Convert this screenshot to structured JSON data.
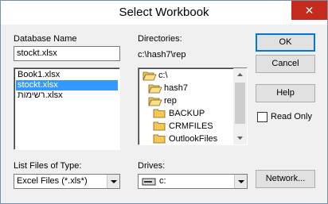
{
  "window": {
    "title": "Select Workbook",
    "close_glyph": "✕"
  },
  "database": {
    "label": "Database Name",
    "value": "stockt.xlsx",
    "files": [
      "Book1.xlsx",
      "stockt.xlsx",
      "רשימות.xlsx"
    ],
    "selected_index": 1
  },
  "directories": {
    "label": "Directories:",
    "current_path": "c:\\hash7\\rep",
    "tree": [
      {
        "name": "c:\\",
        "icon": "open-folder-icon"
      },
      {
        "name": "hash7",
        "icon": "open-folder-icon"
      },
      {
        "name": "rep",
        "icon": "open-folder-icon"
      },
      {
        "name": "BACKUP",
        "icon": "folder-icon"
      },
      {
        "name": "CRMFILES",
        "icon": "folder-icon"
      },
      {
        "name": "OutlookFiles",
        "icon": "folder-icon"
      }
    ]
  },
  "file_type": {
    "label": "List Files of Type:",
    "value": "Excel Files (*.xls*)"
  },
  "drives": {
    "label": "Drives:",
    "value": "c:",
    "icon": "drive-icon"
  },
  "buttons": {
    "ok": "OK",
    "cancel": "Cancel",
    "help": "Help",
    "network": "Network..."
  },
  "read_only": {
    "label": "Read Only",
    "checked": false
  },
  "colors": {
    "selection": "#3399ff",
    "close": "#c42b1c",
    "folder": "#f3c950",
    "default_border": "#0078d7"
  }
}
